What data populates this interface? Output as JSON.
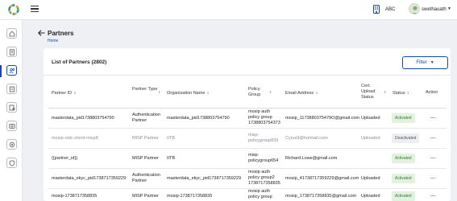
{
  "header": {
    "org_name": "ABC",
    "user_name": "swethauath",
    "caret": "▼"
  },
  "page": {
    "title": "Partners",
    "breadcrumb": "Home"
  },
  "list": {
    "title": "List of Partners (2802)",
    "filter_label": "Filter",
    "filter_caret": "▼",
    "columns": [
      {
        "label": "Partner ID",
        "sortable": true
      },
      {
        "label": "Partner Type",
        "sortable": true
      },
      {
        "label": "Organisation Name",
        "sortable": true
      },
      {
        "label": "Policy Group",
        "sortable": true
      },
      {
        "label": "Email Address",
        "sortable": true
      },
      {
        "label": "Cert. Upload Status",
        "sortable": true
      },
      {
        "label": "Status",
        "sortable": true
      },
      {
        "label": "Action",
        "sortable": false
      }
    ],
    "rows": [
      {
        "partner_id": "masterdata_pid1738803754790",
        "type": [
          "Authentication",
          "Partner"
        ],
        "org": "masterdata_pid1738803754790",
        "policy": [
          "mosip auth",
          "policy group",
          "1738803754373"
        ],
        "email": "mosip_1173880375479O@gmail.com",
        "cert": "Uploaded",
        "status": "Activated",
        "action": "..."
      },
      {
        "partner_id": "mosip-oidc-client-misp8",
        "type": [
          "MISP Partner"
        ],
        "org": "IITB",
        "policy": [
          "misp-",
          "policygroup839"
        ],
        "email": "Cyrus9@hotmail.com",
        "cert": "Uploaded",
        "status": "Deactivated",
        "action": "..."
      },
      {
        "partner_id": "{{partner_id}}",
        "type": [
          "MISP Partner"
        ],
        "org": "IITB",
        "policy": [
          "misp-",
          "policygroup654"
        ],
        "email": "Richard.Lowe@gmail.com",
        "cert": "",
        "status": "Activated",
        "action": "..."
      },
      {
        "partner_id": "masterdata_ekyc_pid1738717359229",
        "type": [
          "Authentication",
          "Partner"
        ],
        "org": "masterdata_ekyc_pid1738717359229",
        "policy": [
          "mosip auth",
          "policy group2",
          "1738717358835"
        ],
        "email": "mosip_41738717359229@gmail.com",
        "cert": "Uploaded",
        "status": "Activated",
        "action": "..."
      },
      {
        "partner_id": "mosip-1738717358835",
        "type": [
          "MISP Partner"
        ],
        "org": "mosip-1738717358835",
        "policy": [
          "mosip auth",
          "policy group"
        ],
        "email": "mosip_1738717358835@gmail.com",
        "cert": "Uploaded",
        "status": "Activated",
        "action": "..."
      }
    ]
  },
  "sidebar": {
    "items": [
      "home-icon",
      "upload-doc-icon",
      "partners-icon",
      "policy-icon",
      "certificate-icon",
      "device-icon",
      "settings-icon",
      "shield-icon"
    ],
    "active_index": 2
  },
  "colors": {
    "accent": "#1447b2",
    "active_badge_bg": "#e3f2df",
    "active_badge_text": "#2f7a2a"
  }
}
